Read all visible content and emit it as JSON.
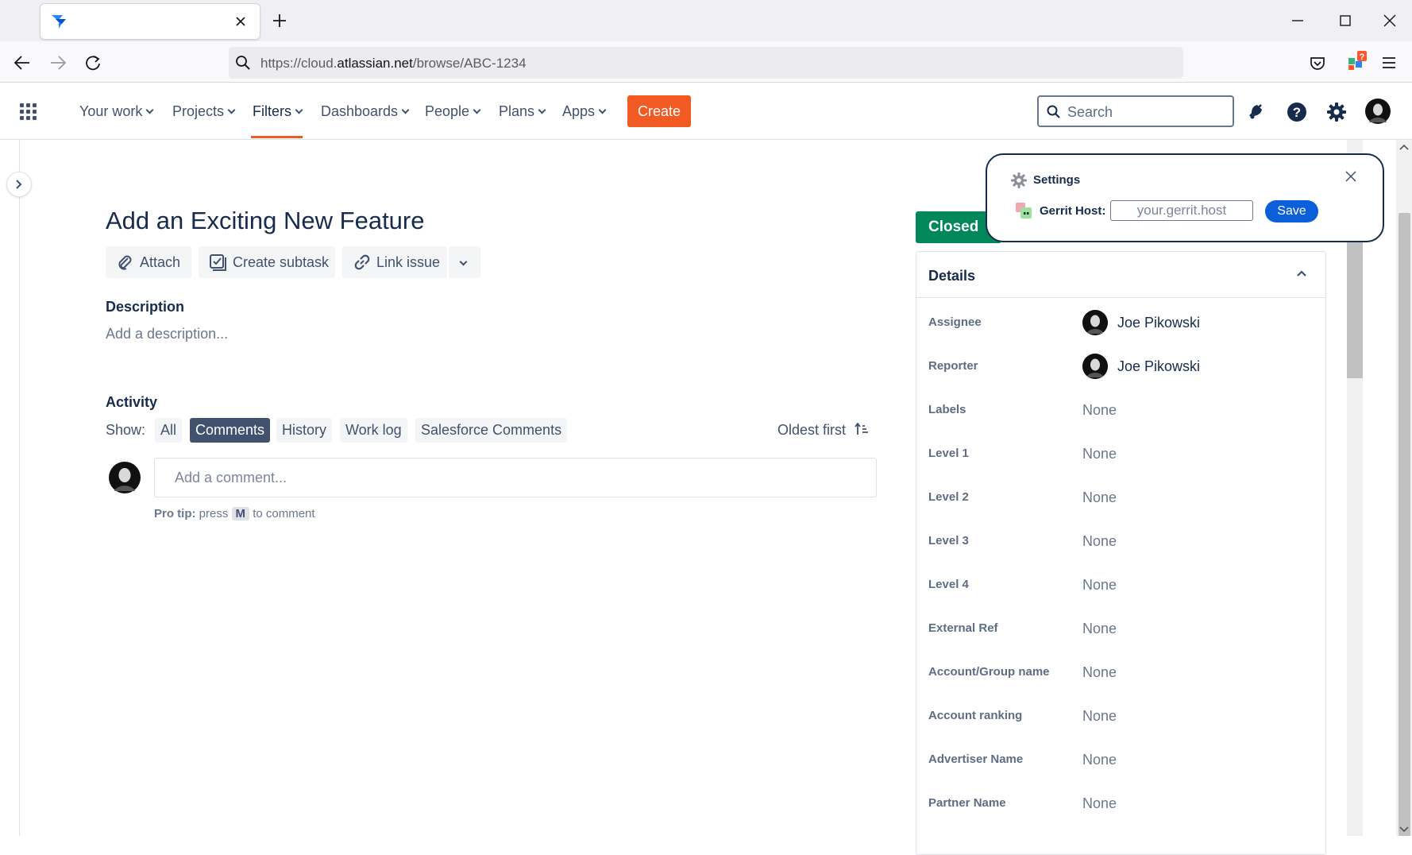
{
  "browser": {
    "url_prefix": "https://cloud.",
    "url_host": "atlassian.net",
    "url_path": "/browse/ABC-1234",
    "tab_title": ""
  },
  "nav": {
    "items": [
      {
        "label": "Your work"
      },
      {
        "label": "Projects"
      },
      {
        "label": "Filters"
      },
      {
        "label": "Dashboards"
      },
      {
        "label": "People"
      },
      {
        "label": "Plans"
      },
      {
        "label": "Apps"
      }
    ],
    "create_label": "Create",
    "search_placeholder": "Search"
  },
  "issue": {
    "title": "Add an Exciting New Feature",
    "actions": {
      "attach": "Attach",
      "create_subtask": "Create subtask",
      "link_issue": "Link issue"
    },
    "description_heading": "Description",
    "description_placeholder": "Add a description...",
    "activity_heading": "Activity",
    "show_label": "Show:",
    "filters": [
      {
        "label": "All"
      },
      {
        "label": "Comments"
      },
      {
        "label": "History"
      },
      {
        "label": "Work log"
      },
      {
        "label": "Salesforce Comments"
      }
    ],
    "sort_label": "Oldest first",
    "comment_placeholder": "Add a comment...",
    "protip_bold": "Pro tip:",
    "protip_press": "press",
    "protip_key": "M",
    "protip_suffix": "to comment"
  },
  "status": {
    "label": "Closed",
    "color": "#00875a"
  },
  "details": {
    "heading": "Details",
    "fields": [
      {
        "label": "Assignee",
        "value": "Joe Pikowski"
      },
      {
        "label": "Reporter",
        "value": "Joe Pikowski"
      },
      {
        "label": "Labels",
        "value": "None"
      },
      {
        "label": "Level 1",
        "value": "None"
      },
      {
        "label": "Level 2",
        "value": "None"
      },
      {
        "label": "Level 3",
        "value": "None"
      },
      {
        "label": "Level 4",
        "value": "None"
      },
      {
        "label": "External Ref",
        "value": "None"
      },
      {
        "label": "Account/Group name",
        "value": "None"
      },
      {
        "label": "Account ranking",
        "value": "None"
      },
      {
        "label": "Advertiser Name",
        "value": "None"
      },
      {
        "label": "Partner Name",
        "value": "None"
      }
    ]
  },
  "popup": {
    "title": "Settings",
    "field_label": "Gerrit Host:",
    "input_placeholder": "your.gerrit.host",
    "save_label": "Save"
  },
  "colors": {
    "create": "#f15a22",
    "accent_underline": "#f15a22",
    "active_chip": "#42526e",
    "save": "#0b5fd8"
  }
}
